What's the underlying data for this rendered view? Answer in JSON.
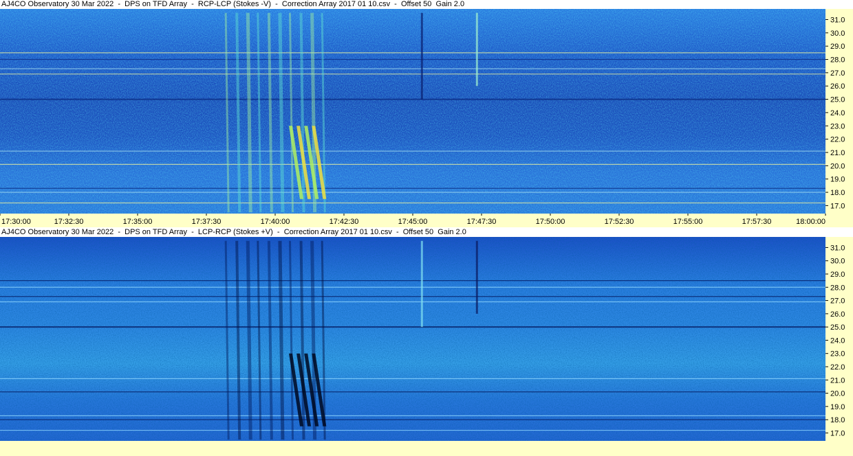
{
  "colors": {
    "background_blue": "#1f5fd0",
    "axis_background": "#ffffc8"
  },
  "chart_data": [
    {
      "type": "heatmap",
      "title": "AJ4CO Observatory 30 Mar 2022  -  DPS on TFD Array  -  RCP-LCP (Stokes -V)  -  Correction Array 2017 01 10.csv  -  Offset 50  Gain 2.0",
      "x_ticks": [
        "17:30:00",
        "17:32:30",
        "17:35:00",
        "17:37:30",
        "17:40:00",
        "17:42:30",
        "17:45:00",
        "17:47:30",
        "17:50:00",
        "17:52:30",
        "17:55:00",
        "17:57:30",
        "18:00:00"
      ],
      "y_ticks": [
        "31.0",
        "30.0",
        "29.0",
        "28.0",
        "27.0",
        "26.0",
        "25.0",
        "24.0",
        "23.0",
        "22.0",
        "21.0",
        "20.0",
        "19.0",
        "18.0",
        "17.0"
      ],
      "xlim": [
        "17:30:00",
        "18:00:00"
      ],
      "ylim": [
        16.4,
        31.8
      ],
      "polarity": "bright",
      "features": [
        {
          "kind": "burst",
          "t_start": "17:38:10",
          "t_end": "17:41:40",
          "f_low": 16.5,
          "f_high": 31.5,
          "intensity": 0.8
        },
        {
          "kind": "burst",
          "t_start": "17:40:30",
          "t_end": "17:41:20",
          "f_low": 17.5,
          "f_high": 23.0,
          "intensity": 1.0
        },
        {
          "kind": "vertical_line",
          "t": "17:47:20",
          "f_low": 26.0,
          "f_high": 31.5,
          "intensity": 0.5
        },
        {
          "kind": "vertical_line",
          "t": "17:45:20",
          "f_low": 25.0,
          "f_high": 31.5,
          "intensity": -0.5
        }
      ]
    },
    {
      "type": "heatmap",
      "title": "AJ4CO Observatory 30 Mar 2022  -  DPS on TFD Array  -  LCP-RCP (Stokes +V)  -  Correction Array 2017 01 10.csv  -  Offset 50  Gain 2.0",
      "x_ticks": [],
      "y_ticks": [
        "31.0",
        "30.0",
        "29.0",
        "28.0",
        "27.0",
        "26.0",
        "25.0",
        "24.0",
        "23.0",
        "22.0",
        "21.0",
        "20.0",
        "19.0",
        "18.0",
        "17.0"
      ],
      "xlim": [
        "17:30:00",
        "18:00:00"
      ],
      "ylim": [
        16.4,
        31.8
      ],
      "polarity": "dark",
      "features": [
        {
          "kind": "burst",
          "t_start": "17:38:10",
          "t_end": "17:41:40",
          "f_low": 16.5,
          "f_high": 31.5,
          "intensity": 0.8
        },
        {
          "kind": "burst",
          "t_start": "17:40:30",
          "t_end": "17:41:20",
          "f_low": 17.5,
          "f_high": 23.0,
          "intensity": 1.0
        },
        {
          "kind": "vertical_line",
          "t": "17:47:20",
          "f_low": 26.0,
          "f_high": 31.5,
          "intensity": 0.6
        },
        {
          "kind": "vertical_line",
          "t": "17:45:20",
          "f_low": 25.0,
          "f_high": 31.5,
          "intensity": -0.4
        }
      ]
    }
  ]
}
